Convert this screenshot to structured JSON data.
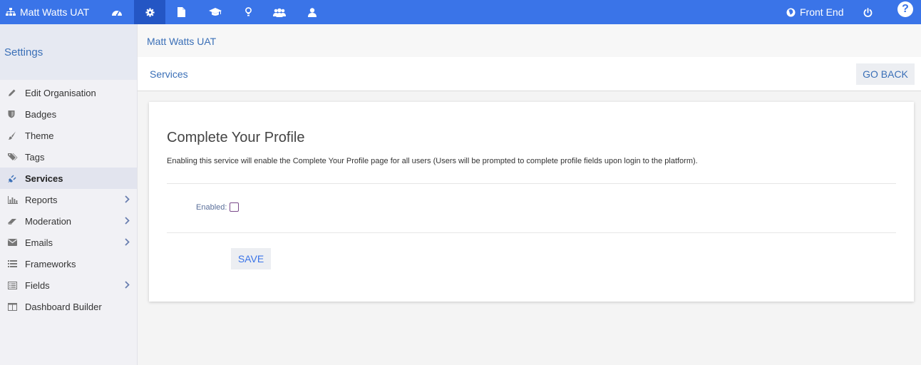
{
  "topbar": {
    "brand": "Matt Watts UAT",
    "nav_icons": [
      "dashboard-icon",
      "gear-icon",
      "file-icon",
      "graduation-cap-icon",
      "lightbulb-icon",
      "users-icon",
      "user-icon"
    ],
    "active_icon": "gear-icon",
    "front_end": "Front End",
    "help": "?"
  },
  "sidebar": {
    "title": "Settings",
    "items": [
      {
        "label": "Edit Organisation",
        "icon": "pencil-icon",
        "has_submenu": false
      },
      {
        "label": "Badges",
        "icon": "shield-icon",
        "has_submenu": false
      },
      {
        "label": "Theme",
        "icon": "brush-icon",
        "has_submenu": false
      },
      {
        "label": "Tags",
        "icon": "tags-icon",
        "has_submenu": false
      },
      {
        "label": "Services",
        "icon": "plug-icon",
        "has_submenu": false,
        "active": true
      },
      {
        "label": "Reports",
        "icon": "bar-chart-icon",
        "has_submenu": true
      },
      {
        "label": "Moderation",
        "icon": "eraser-icon",
        "has_submenu": true
      },
      {
        "label": "Emails",
        "icon": "envelope-icon",
        "has_submenu": true
      },
      {
        "label": "Frameworks",
        "icon": "list-icon",
        "has_submenu": false
      },
      {
        "label": "Fields",
        "icon": "list-alt-icon",
        "has_submenu": true
      },
      {
        "label": "Dashboard Builder",
        "icon": "columns-icon",
        "has_submenu": false
      }
    ]
  },
  "header": {
    "org_name": "Matt Watts UAT",
    "page_title": "Services",
    "go_back": "GO BACK"
  },
  "card": {
    "title": "Complete Your Profile",
    "description": "Enabling this service will enable the Complete Your Profile page for all users (Users will be prompted to complete profile fields upon login to the platform).",
    "enabled_label": "Enabled:",
    "enabled_checked": false,
    "save_label": "SAVE"
  },
  "colors": {
    "topbar": "#3a74e8",
    "topbar_active": "#2456c4",
    "link": "#3a6fb7",
    "sidebar_bg": "#f1f1f5"
  }
}
